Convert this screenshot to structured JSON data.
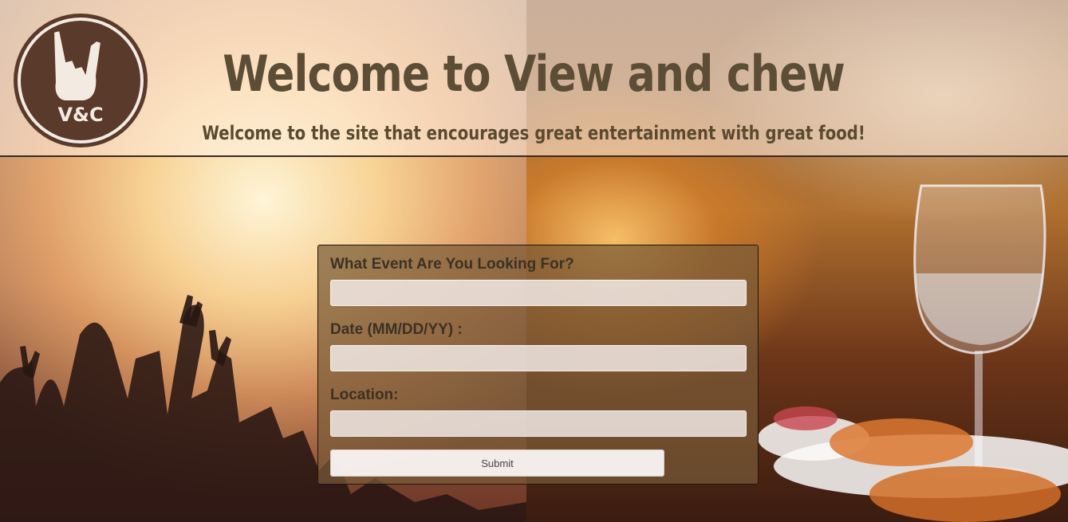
{
  "header": {
    "logo_text": "V&C",
    "title": "Welcome to View and chew",
    "subtitle": "Welcome to the site that encourages great entertainment with great food!"
  },
  "form": {
    "event_label": "What Event Are You Looking For?",
    "event_value": "",
    "date_label": "Date (MM/DD/YY) :",
    "date_value": "",
    "location_label": "Location:",
    "location_value": "",
    "submit_label": "Submit"
  },
  "colors": {
    "logo_fill": "#5a3a2a",
    "title": "#5c4e36",
    "form_bg": "#785a37"
  },
  "icons": {
    "logo": "rock-hand-icon"
  }
}
